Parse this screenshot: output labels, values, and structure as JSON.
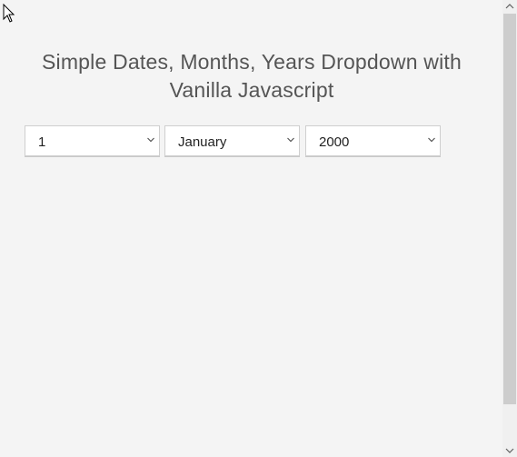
{
  "header": {
    "title_line1": "Simple Dates, Months, Years Dropdown with",
    "title_line2": "Vanilla Javascript"
  },
  "dropdowns": {
    "day": {
      "selected": "1"
    },
    "month": {
      "selected": "January"
    },
    "year": {
      "selected": "2000"
    }
  },
  "icons": {
    "pointer": "mouse-pointer-icon",
    "chevron": "chevron-down-icon",
    "scroll_up": "scroll-up-arrow-icon",
    "scroll_down": "scroll-down-arrow-icon"
  },
  "colors": {
    "background": "#f4f4f4",
    "title": "#555555",
    "select_border": "#cfcfcf",
    "scroll_thumb": "#cdcdcd"
  }
}
